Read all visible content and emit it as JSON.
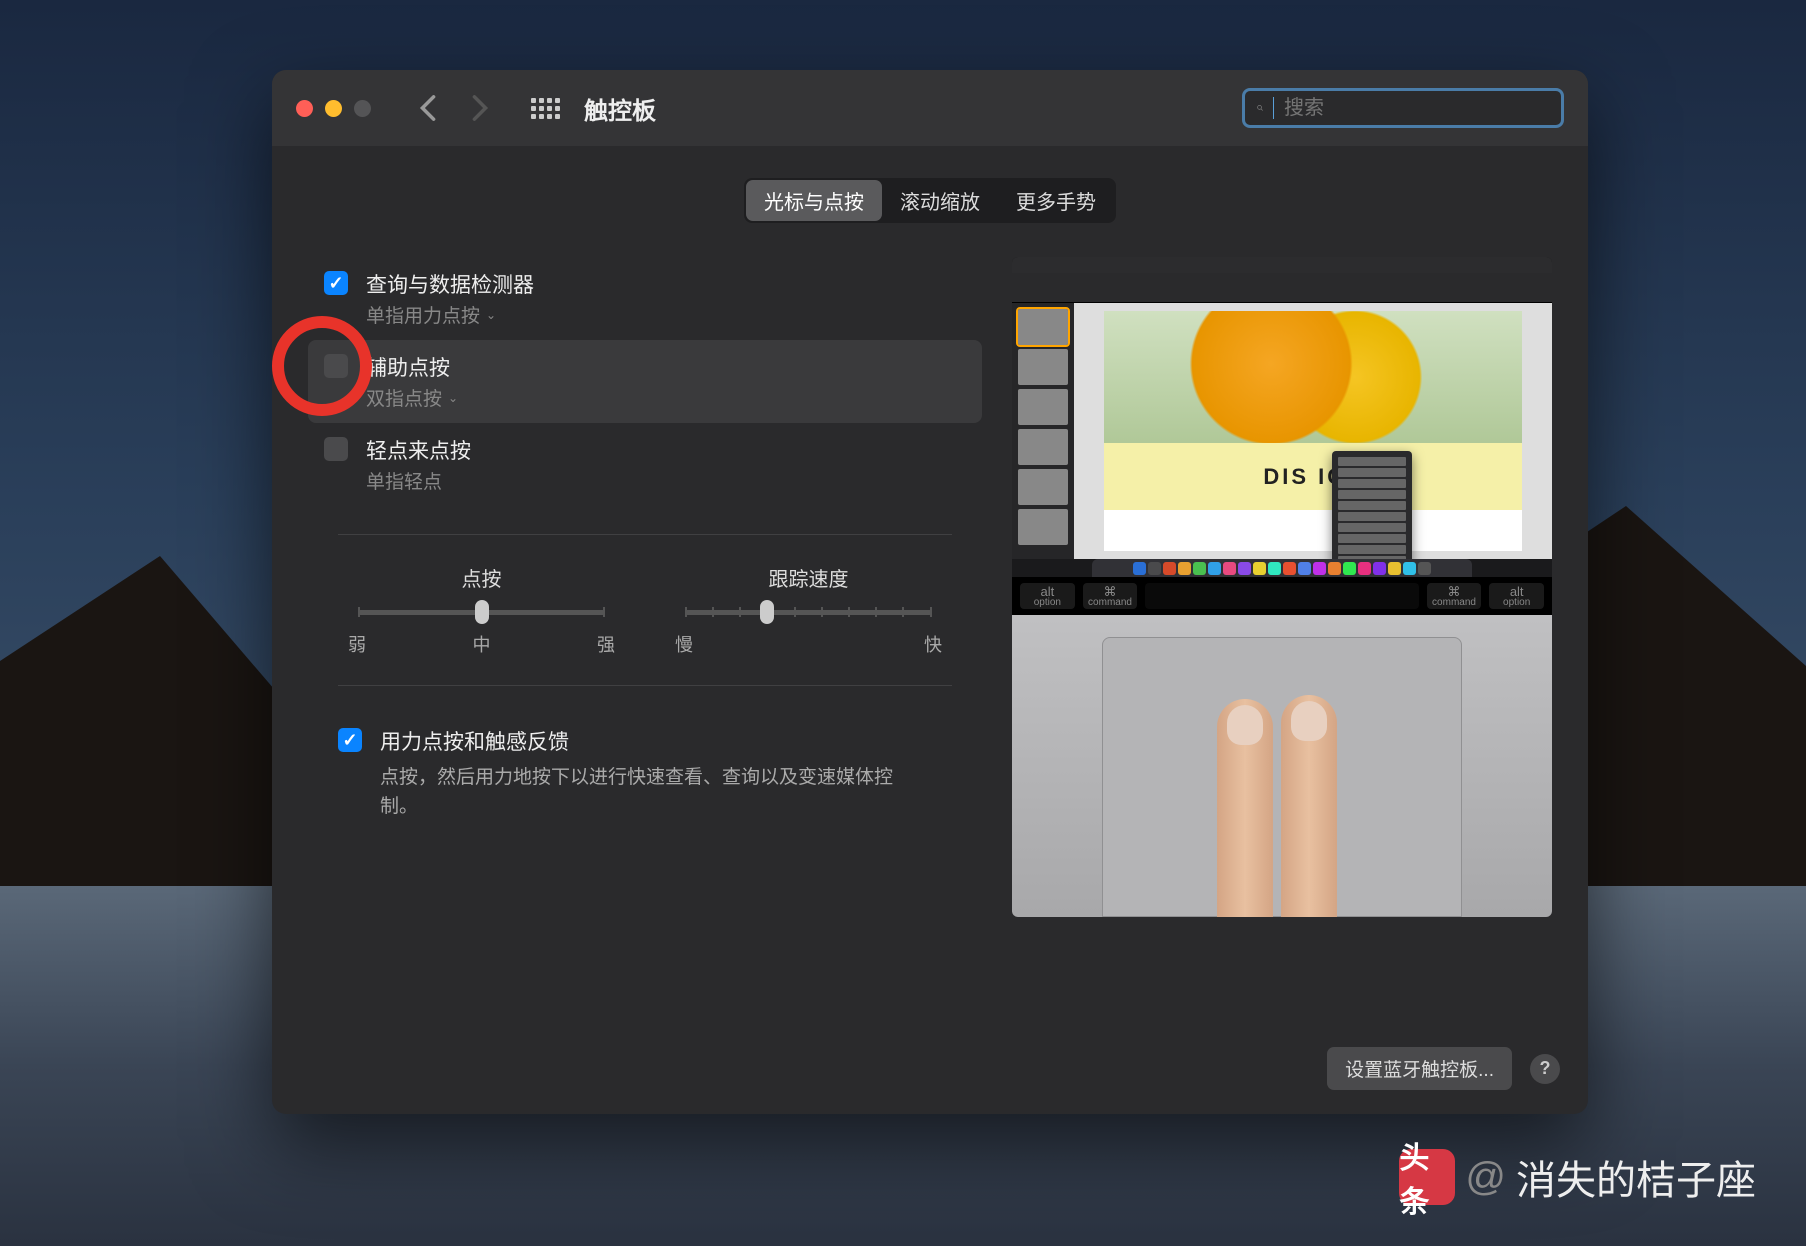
{
  "window": {
    "title": "触控板",
    "search_placeholder": "搜索"
  },
  "tabs": [
    "光标与点按",
    "滚动缩放",
    "更多手势"
  ],
  "options": {
    "lookup": {
      "title": "查询与数据检测器",
      "sub": "单指用力点按"
    },
    "secondary": {
      "title": "辅助点按",
      "sub": "双指点按"
    },
    "tap": {
      "title": "轻点来点按",
      "sub": "单指轻点"
    }
  },
  "sliders": {
    "click": {
      "title": "点按",
      "labels": [
        "弱",
        "中",
        "强"
      ]
    },
    "track": {
      "title": "跟踪速度",
      "labels": [
        "慢",
        "快"
      ]
    }
  },
  "force": {
    "title": "用力点按和触感反馈",
    "desc": "点按，然后用力地按下以进行快速查看、查询以及变速媒体控制。"
  },
  "preview": {
    "banner": "DIS   ICT",
    "touchbar": [
      "alt\noption",
      "⌘\ncommand",
      "",
      "",
      "⌘\ncommand",
      "alt\noption"
    ]
  },
  "footer": {
    "bluetooth": "设置蓝牙触控板...",
    "help": "?"
  },
  "watermark": {
    "logo": "头条",
    "at": "@",
    "name": "消失的桔子座"
  }
}
